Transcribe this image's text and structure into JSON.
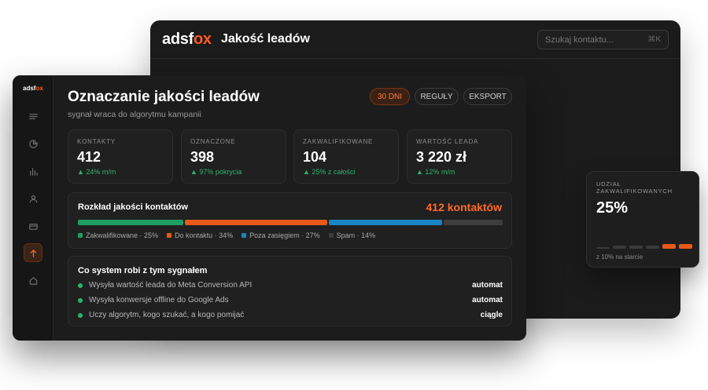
{
  "back_window": {
    "logo": "adsfox",
    "title": "Jakość leadów",
    "search": {
      "placeholder": "Szukaj kontaktu...",
      "shortcut": "⌘K"
    }
  },
  "sidebar": {
    "logo": "adsfox",
    "items": [
      {
        "icon": "menu-icon",
        "active": false
      },
      {
        "icon": "pie-chart-icon",
        "active": false
      },
      {
        "icon": "bar-chart-icon",
        "active": false
      },
      {
        "icon": "user-icon",
        "active": false
      },
      {
        "icon": "card-icon",
        "active": false
      },
      {
        "icon": "upload-arrow-icon",
        "active": true
      },
      {
        "icon": "home-icon",
        "active": false
      }
    ]
  },
  "main": {
    "title": "Oznaczanie jakości leadów",
    "subtitle": "sygnał wraca do algorytmu kampanii",
    "filters": [
      {
        "label": "30 DNI",
        "active": true
      },
      {
        "label": "REGUŁY",
        "active": false
      },
      {
        "label": "EKSPORT",
        "active": false
      }
    ],
    "stats": [
      {
        "label": "KONTAKTY",
        "value": "412",
        "delta": "▲ 24% m/m"
      },
      {
        "label": "OZNACZONE",
        "value": "398",
        "delta": "▲ 97% pokrycia"
      },
      {
        "label": "ZAKWALIFIKOWANE",
        "value": "104",
        "delta": "▲ 25% z całości"
      },
      {
        "label": "WARTOŚĆ LEADA",
        "value": "3 220 zł",
        "delta": "▲ 12% m/m"
      }
    ],
    "distribution": {
      "title": "Rozkład jakości kontaktów",
      "total": "412 kontaktów",
      "segments": [
        {
          "label": "Zakwalifikowane · 25%",
          "share": 25,
          "color": "#1f9e64"
        },
        {
          "label": "Do kontaktu · 34%",
          "share": 34,
          "color": "#e8591a"
        },
        {
          "label": "Poza zasięgiem · 27%",
          "share": 27,
          "color": "#1a85c4"
        },
        {
          "label": "Spam · 14%",
          "share": 14,
          "color": "#3e3e3e"
        }
      ]
    },
    "actions": {
      "title": "Co system robi z tym sygnałem",
      "items": [
        {
          "text": "Wysyła wartość leada do Meta Conversion API",
          "tag": "automat"
        },
        {
          "text": "Wysyła konwersje offline do Google Ads",
          "tag": "automat"
        },
        {
          "text": "Uczy algorytm, kogo szukać, a kogo pomijać",
          "tag": "ciągle"
        }
      ]
    }
  },
  "float_card": {
    "label": "UDZIAŁ ZAKWALIFIKOWANYCH",
    "value": "25%",
    "footnote": "z 10% na starcie",
    "trend_colors": [
      "#3a3a3a",
      "#3a3a3a",
      "#3a3a3a",
      "#3a3a3a",
      "#e8591a",
      "#e8591a"
    ]
  },
  "colors": {
    "accent": "#ff6a26",
    "positive": "#2bb36e",
    "background": "#1c1c1c"
  }
}
